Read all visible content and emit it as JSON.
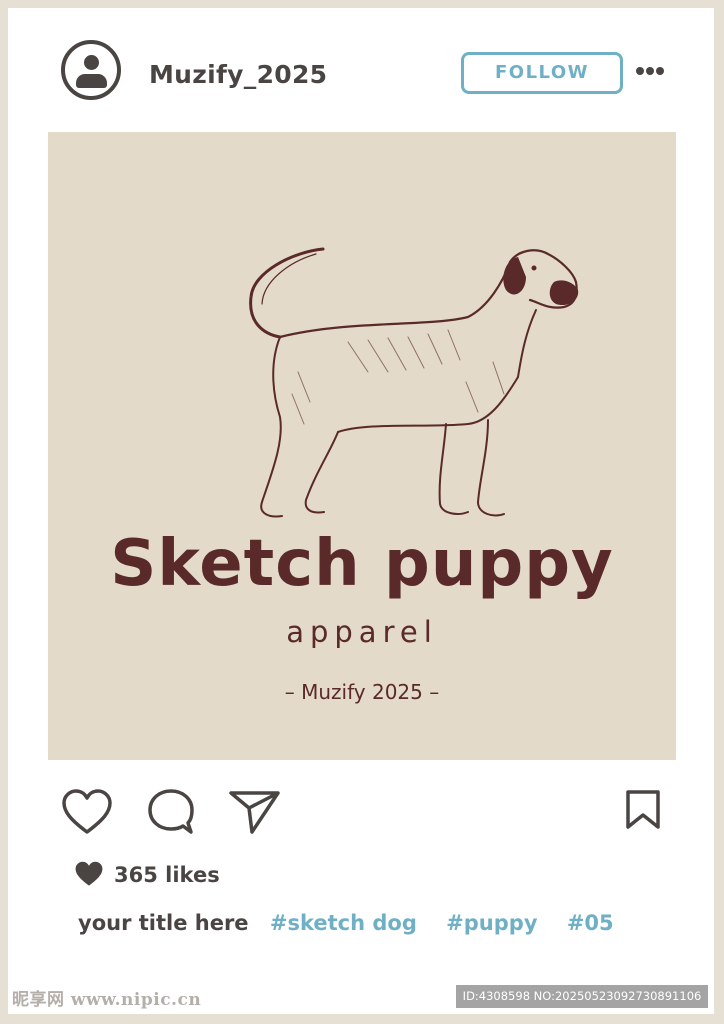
{
  "post": {
    "username": "Muzify_2025",
    "follow_label": "FOLLOW",
    "likes_label": "365 likes",
    "caption_title": "your title here",
    "hashtags": [
      "#sketch dog",
      "#puppy",
      "#05"
    ]
  },
  "image": {
    "brand_title": "Sketch puppy",
    "brand_subtitle": "apparel",
    "brand_tagline": "– Muzify 2025 –"
  },
  "watermark": {
    "site": "昵享网 www.nipic.cn",
    "id_text": "ID:4308598 NO:20250523092730891106"
  },
  "colors": {
    "accent": "#6fb0c6",
    "dark": "#4a4543",
    "brand": "#5a2a2a",
    "image_bg": "#e3dac9",
    "frame": "#e6dfd3"
  },
  "icons": [
    "user-avatar-icon",
    "more-dots-icon",
    "heart-icon",
    "comment-icon",
    "send-icon",
    "bookmark-icon",
    "heart-filled-icon"
  ]
}
